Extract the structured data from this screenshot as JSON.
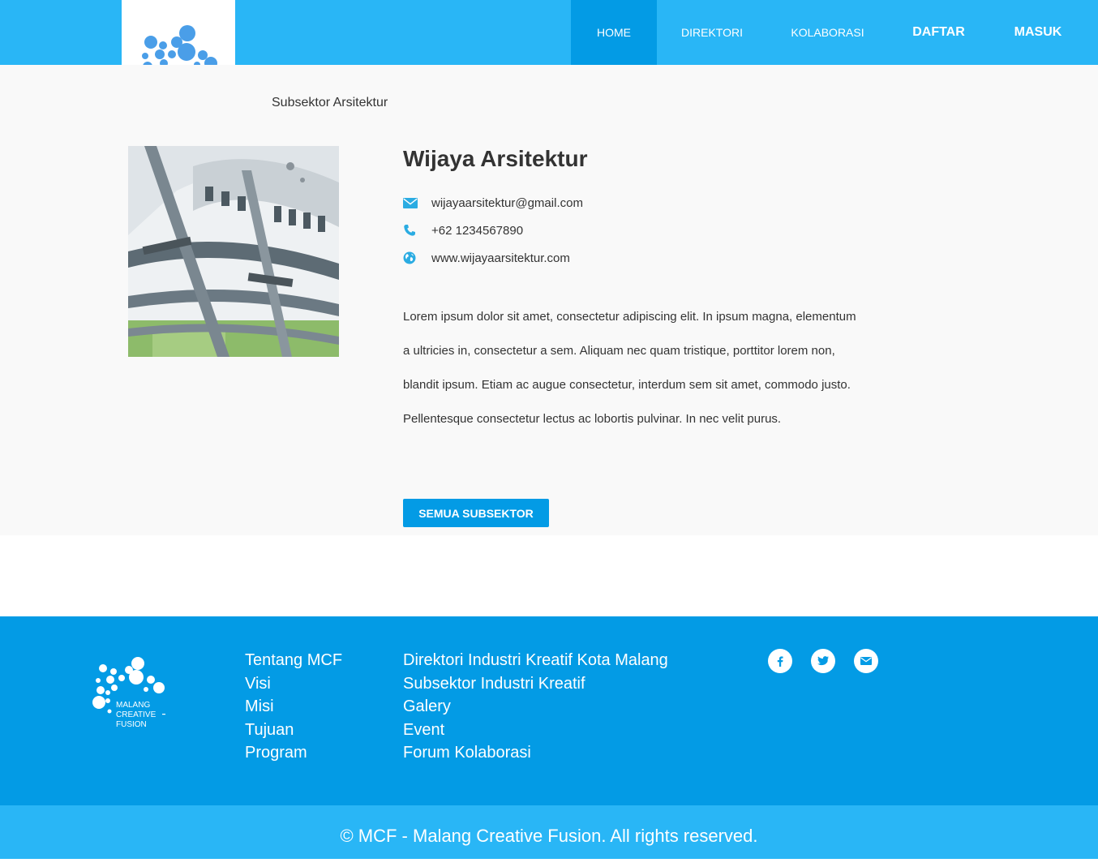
{
  "header": {
    "logo_text": [
      "MALANG",
      "CREATIVE",
      "FUSION"
    ],
    "nav": [
      {
        "label": "HOME",
        "active": true
      },
      {
        "label": "DIREKTORI"
      },
      {
        "label": "KOLABORASI"
      },
      {
        "label": "DAFTAR"
      },
      {
        "label": "MASUK"
      }
    ]
  },
  "breadcrumb": "Subsektor Arsitektur",
  "profile": {
    "name": "Wijaya Arsitektur",
    "email": "wijayaarsitektur@gmail.com",
    "phone": "+62 1234567890",
    "website": "www.wijayaarsitektur.com",
    "description": "Lorem ipsum dolor sit amet, consectetur adipiscing elit. In ipsum magna, elementum a ultricies in, consectetur a sem. Aliquam nec quam tristique, porttitor lorem non, blandit ipsum. Etiam ac augue consectetur, interdum sem sit amet, commodo justo. Pellentesque consectetur lectus ac lobortis pulvinar. In nec velit purus.",
    "button_label": "SEMUA SUBSEKTOR"
  },
  "footer": {
    "about_links": [
      "Tentang MCF",
      "Visi",
      "Misi",
      "Tujuan",
      "Program"
    ],
    "site_links": [
      "Direktori Industri Kreatif Kota Malang",
      "Subsektor Industri Kreatif",
      "Galery",
      "Event",
      "Forum Kolaborasi"
    ],
    "social_icons": [
      "facebook-icon",
      "twitter-icon",
      "envelope-icon"
    ],
    "copyright": "© MCF - Malang Creative Fusion. All rights reserved."
  },
  "colors": {
    "header_bg": "#29b6f6",
    "accent": "#039be5",
    "logo_blue": "#4a9ee8"
  }
}
